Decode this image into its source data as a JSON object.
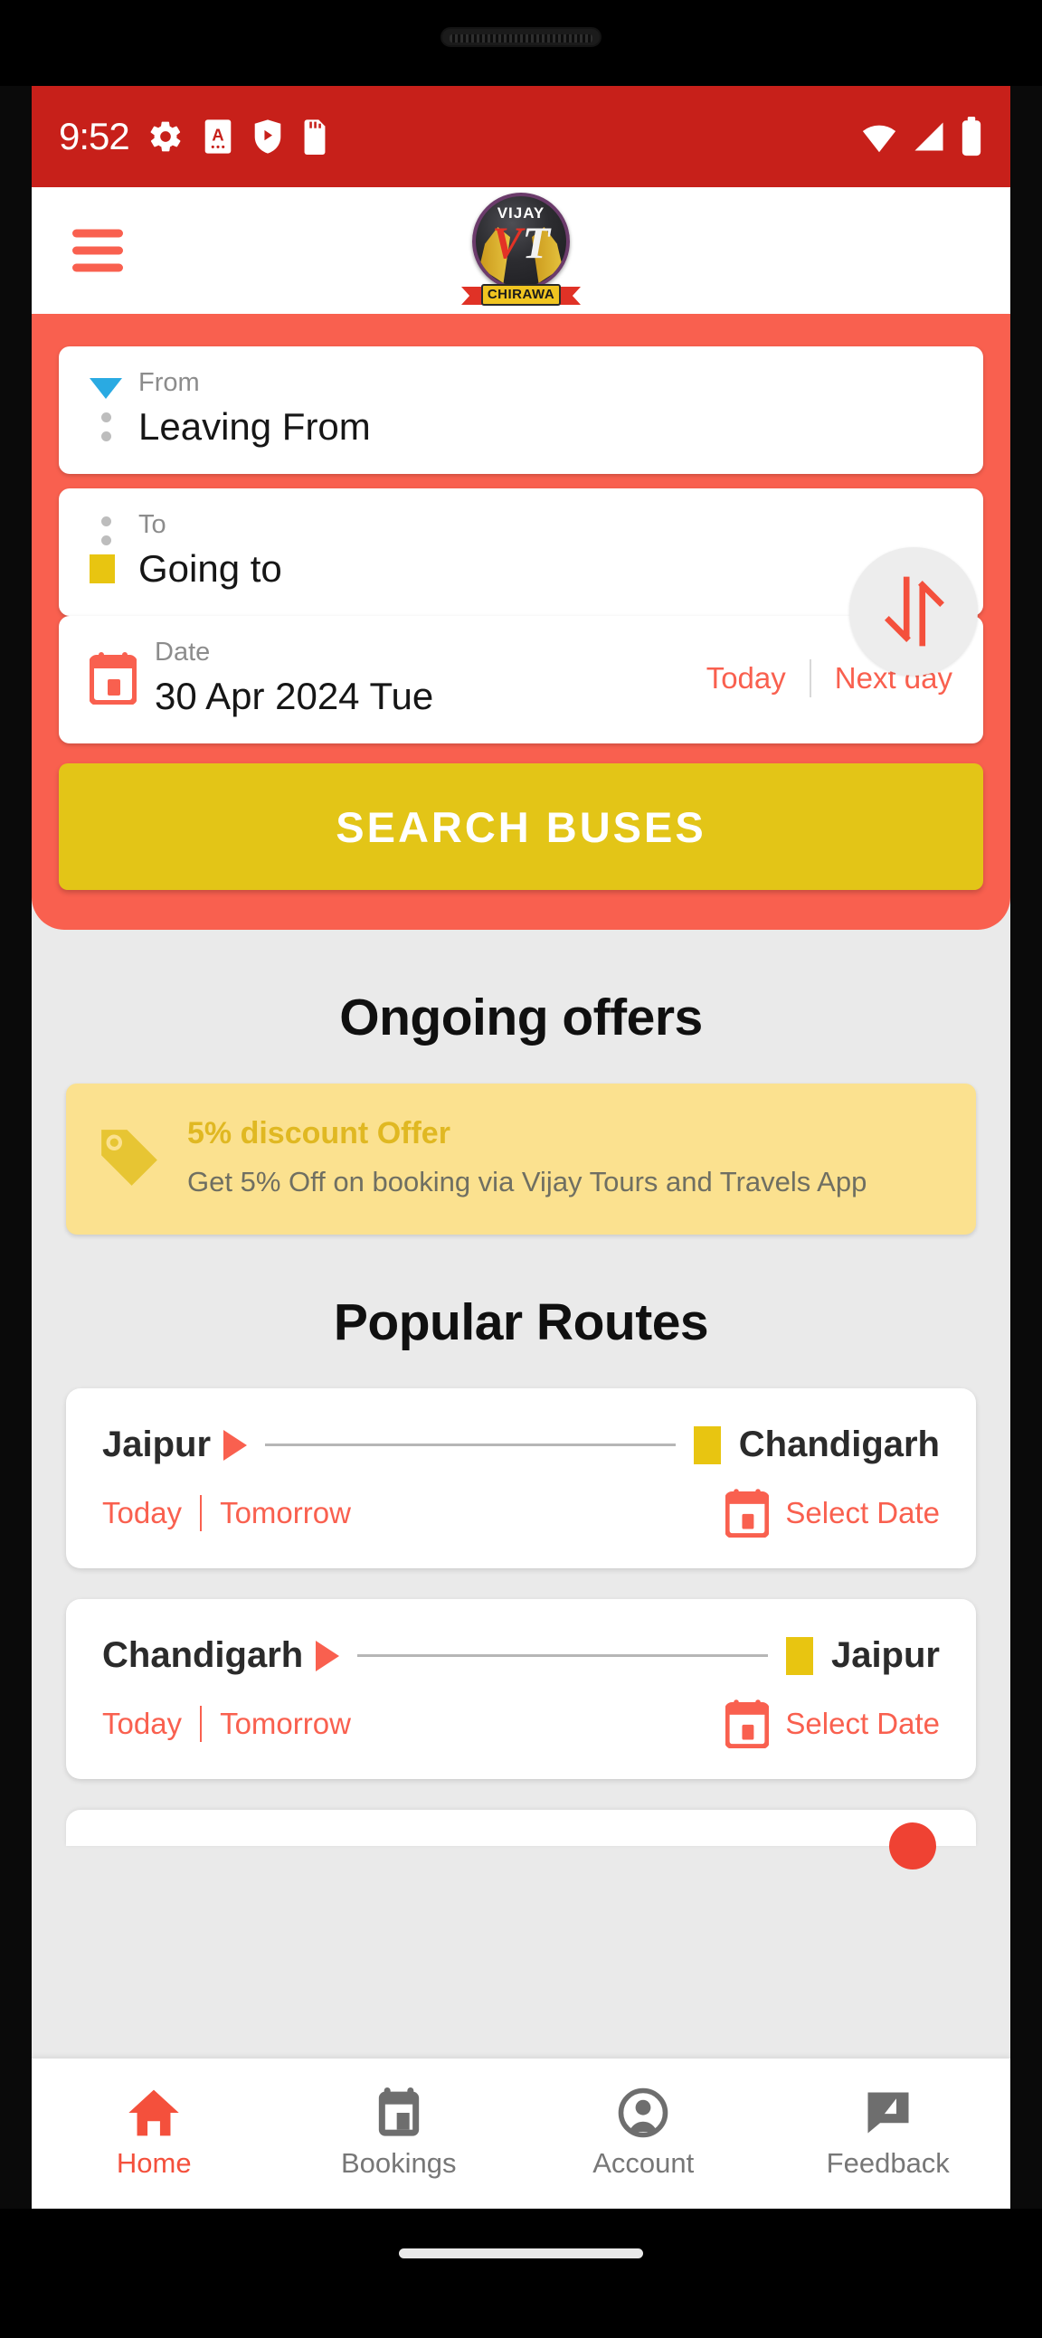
{
  "status_bar": {
    "time": "9:52",
    "left_icons": [
      "gear-icon",
      "alphabet-app-icon",
      "play-protect-icon",
      "sd-card-icon"
    ],
    "right_icons": [
      "wifi-icon",
      "cellular-signal-icon",
      "battery-icon"
    ],
    "background_color": "#c7201a"
  },
  "app_bar": {
    "menu_icon": "hamburger-menu-icon",
    "logo": {
      "top_text": "VIJAY",
      "monogram_v": "V",
      "monogram_t": "T",
      "ribbon_text": "CHIRAWA"
    }
  },
  "search_panel": {
    "background_color": "#f9604f",
    "from": {
      "label": "From",
      "value": "Leaving From",
      "icon": "blue-triangle-down-icon"
    },
    "to": {
      "label": "To",
      "value": "Going to",
      "icon": "yellow-square-icon"
    },
    "swap_icon": "swap-arrows-icon",
    "date": {
      "label": "Date",
      "value": "30 Apr 2024 Tue",
      "icon": "calendar-icon",
      "today_label": "Today",
      "next_day_label": "Next day"
    },
    "search_button_label": "SEARCH BUSES",
    "search_button_color": "#e3c517"
  },
  "offers": {
    "heading": "Ongoing offers",
    "card": {
      "icon": "price-tag-icon",
      "title": "5% discount Offer",
      "subtitle": "Get 5% Off on booking via Vijay Tours and Travels App",
      "background_color": "#fbe18f",
      "title_color": "#e0b822"
    }
  },
  "popular_routes": {
    "heading": "Popular Routes",
    "routes": [
      {
        "origin": "Jaipur",
        "destination": "Chandigarh",
        "today_label": "Today",
        "tomorrow_label": "Tomorrow",
        "select_date_label": "Select Date",
        "calendar_icon": "calendar-icon"
      },
      {
        "origin": "Chandigarh",
        "destination": "Jaipur",
        "today_label": "Today",
        "tomorrow_label": "Tomorrow",
        "select_date_label": "Select Date",
        "calendar_icon": "calendar-icon"
      }
    ]
  },
  "bottom_nav": {
    "active_color": "#f4503c",
    "inactive_color": "#777777",
    "items": [
      {
        "label": "Home",
        "icon": "home-icon",
        "active": true
      },
      {
        "label": "Bookings",
        "icon": "ticket-icon",
        "active": false
      },
      {
        "label": "Account",
        "icon": "person-icon",
        "active": false
      },
      {
        "label": "Feedback",
        "icon": "feedback-icon",
        "active": false
      }
    ]
  }
}
